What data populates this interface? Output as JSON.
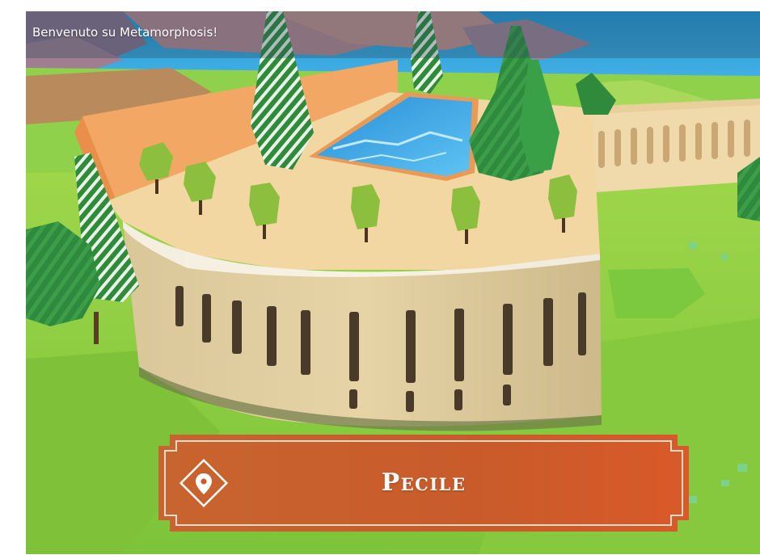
{
  "header": {
    "welcome_text": "Benvenuto su Metamorphosis!"
  },
  "location_banner": {
    "place_name": "Pecile",
    "icon": "location-pin-icon",
    "color": "#c95b2b"
  },
  "colors": {
    "grass": "#8ccf3a",
    "sky": "#2f9fd8",
    "sand_terrace": "#f1d7a4",
    "wall_orange": "#f3a764",
    "pool_water": "#3ba9e6",
    "tree_dark": "#2f8a3c",
    "tree_light": "#8cbf3e"
  }
}
